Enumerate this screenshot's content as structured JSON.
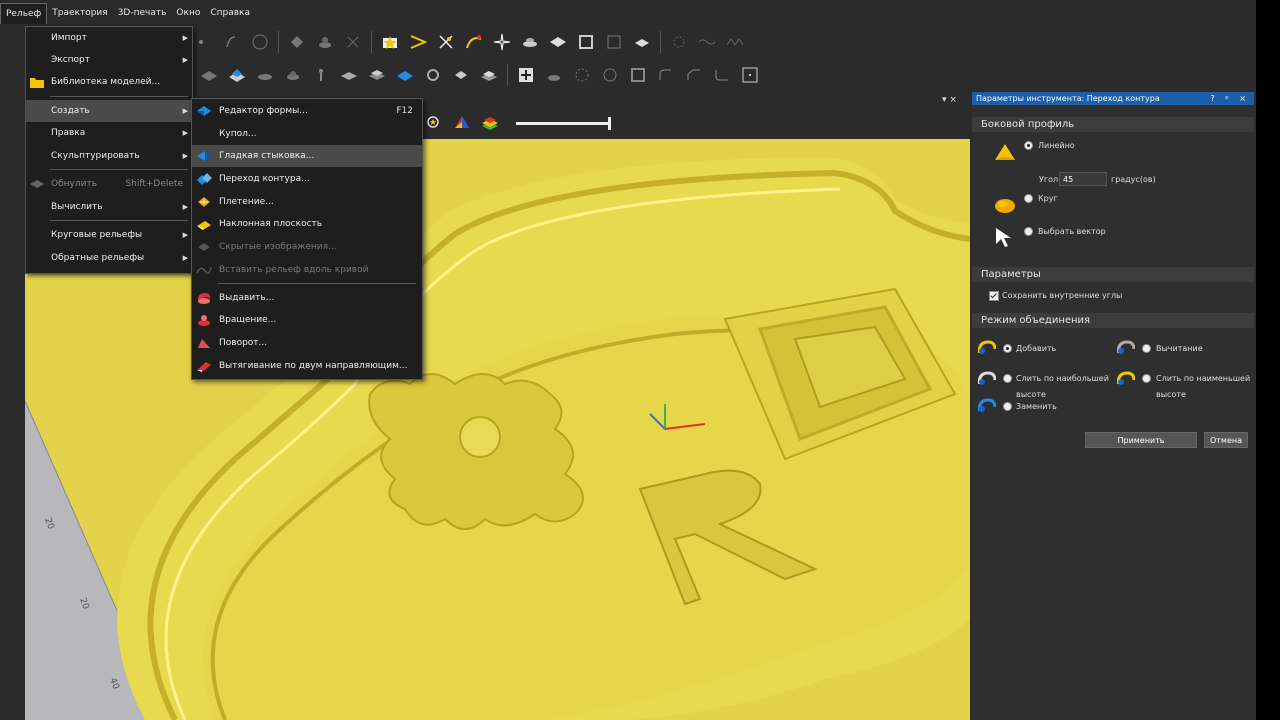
{
  "menubar": {
    "items": [
      "Рельеф",
      "Траектория",
      "3D-печать",
      "Окно",
      "Справка"
    ]
  },
  "menu_main": {
    "items": [
      {
        "label": "Импорт",
        "submenu": true,
        "icon": ""
      },
      {
        "label": "Экспорт",
        "submenu": true,
        "icon": ""
      },
      {
        "label": "Библиотека моделей...",
        "icon": "folder-icon"
      },
      {
        "label": "Создать",
        "submenu": true,
        "highlighted": true
      },
      {
        "label": "Правка",
        "submenu": true
      },
      {
        "label": "Скульптурировать",
        "submenu": true
      },
      {
        "label": "Обнулить",
        "shortcut": "Shift+Delete",
        "disabled": true,
        "icon": "diamond-icon"
      },
      {
        "label": "Вычислить",
        "submenu": true
      },
      {
        "label": "Круговые рельефы",
        "submenu": true
      },
      {
        "label": "Обратные рельефы",
        "submenu": true
      }
    ]
  },
  "menu_create": {
    "items": [
      {
        "label": "Редактор формы...",
        "shortcut": "F12",
        "icon": "shape-editor-icon"
      },
      {
        "label": "Купол...",
        "icon": ""
      },
      {
        "label": "Гладкая стыковка...",
        "highlighted": true,
        "icon": "smooth-join-icon"
      },
      {
        "label": "Переход контура...",
        "icon": "contour-transition-icon"
      },
      {
        "label": "Плетение...",
        "icon": "weave-icon"
      },
      {
        "label": "Наклонная плоскость",
        "icon": "tilted-plane-icon"
      },
      {
        "label": "Скрытые изображения...",
        "disabled": true,
        "icon": "hidden-images-icon"
      },
      {
        "label": "Вставить рельеф вдоль кривой",
        "disabled": true,
        "icon": "curve-relief-icon"
      },
      {
        "label": "Выдавить...",
        "icon": "extrude-icon"
      },
      {
        "label": "Вращение...",
        "icon": "spin-icon"
      },
      {
        "label": "Поворот...",
        "icon": "turn-icon"
      },
      {
        "label": "Вытягивание по двум направляющим...",
        "icon": "two-rail-sweep-icon"
      }
    ]
  },
  "panel": {
    "title": "Параметры инструмента: Переход контура",
    "title_buttons": "? ᵖ ×",
    "side_profile": {
      "heading": "Боковой профиль",
      "linear_label": "Линейно",
      "angle_label": "Угол",
      "angle_value": "45",
      "angle_unit": "градус(ов)",
      "circle_label": "Круг",
      "vector_label": "Выбрать вектор"
    },
    "params": {
      "heading": "Параметры",
      "keep_corners_label": "Сохранить внутренние углы"
    },
    "combine": {
      "heading": "Режим объединения",
      "add_label": "Добавить",
      "subtract_label": "Вычитание",
      "merge_high_label_1": "Слить по наибольшей",
      "merge_high_label_2": "высоте",
      "merge_low_label_1": "Слить по наименьшей",
      "merge_low_label_2": "высоте",
      "replace_label": "Заменить"
    },
    "apply_label": "Применить",
    "cancel_label": "Отмена"
  },
  "viewport": {
    "ruler_ticks": [
      "20",
      "20",
      "40"
    ],
    "relief_letter": "R"
  },
  "colors": {
    "relief": "#e3d34a",
    "panel_header": "#1c5ea8",
    "menu_bg": "#1e1e1e"
  }
}
